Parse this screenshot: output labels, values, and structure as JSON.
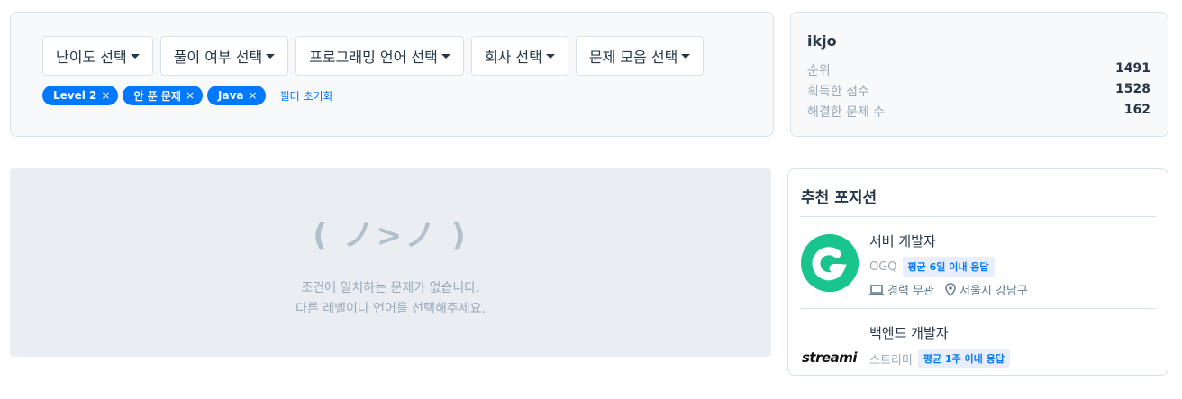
{
  "filters": {
    "dropdowns": [
      {
        "label": "난이도 선택"
      },
      {
        "label": "풀이 여부 선택"
      },
      {
        "label": "프로그래밍 언어 선택"
      },
      {
        "label": "회사 선택"
      },
      {
        "label": "문제 모음 선택"
      }
    ],
    "chips": [
      {
        "label": "Level 2"
      },
      {
        "label": "안 푼 문제"
      },
      {
        "label": "Java"
      }
    ],
    "remove_glyph": "×",
    "reset_label": "필터 초기화"
  },
  "profile": {
    "username": "ikjo",
    "stats": [
      {
        "label": "순위",
        "value": "1491"
      },
      {
        "label": "획득한 점수",
        "value": "1528"
      },
      {
        "label": "해결한 문제 수",
        "value": "162"
      }
    ]
  },
  "empty_state": {
    "emoticon": "( ノ>ノ )",
    "line1": "조건에 일치하는 문제가 없습니다.",
    "line2": "다른 레벨이나 언어를 선택해주세요."
  },
  "recommended": {
    "title": "추천 포지션",
    "jobs": [
      {
        "position": "서버 개발자",
        "company": "OGQ",
        "badge": "평균 6일 이내 응답",
        "career": "경력 무관",
        "location": "서울시 강남구",
        "logo": "ogq-logo"
      },
      {
        "position": "백엔드 개발자",
        "company": "스트리미",
        "badge": "평균 1주 이내 응답",
        "logo_text": "streami",
        "logo": "streami-logo"
      }
    ]
  },
  "colors": {
    "accent": "#0078ff",
    "ogq_green": "#19c58c",
    "panel_bg": "#f8f9fb",
    "empty_bg": "#eaedf1"
  }
}
